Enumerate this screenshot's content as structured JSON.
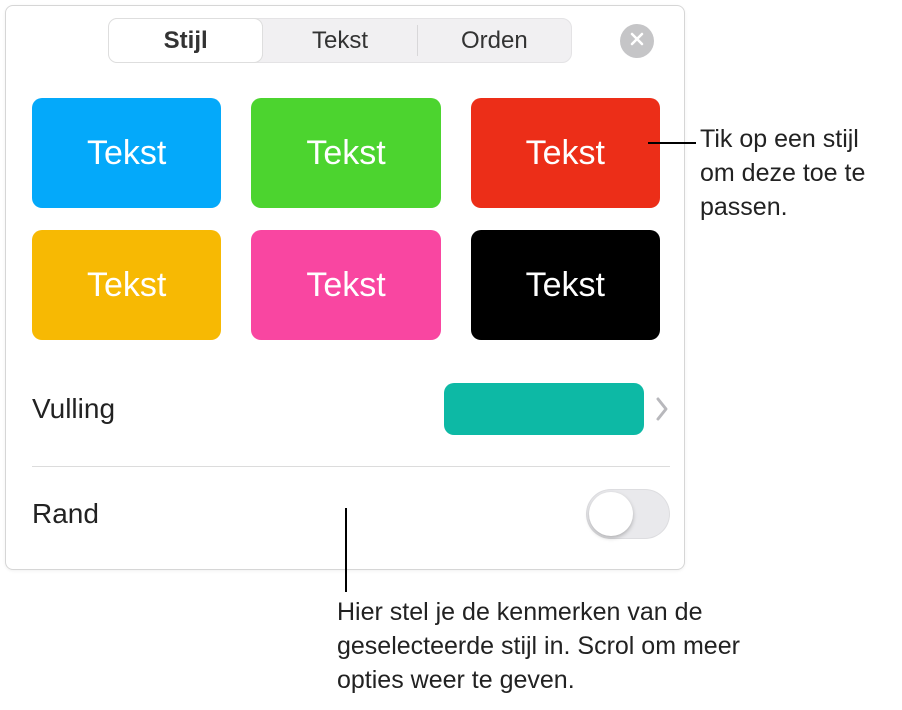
{
  "tabs": {
    "stijl": "Stijl",
    "tekst": "Tekst",
    "orden": "Orden"
  },
  "swatches": [
    {
      "label": "Tekst",
      "color": "#04a9fa"
    },
    {
      "label": "Tekst",
      "color": "#4cd42f"
    },
    {
      "label": "Tekst",
      "color": "#ec2e18"
    },
    {
      "label": "Tekst",
      "color": "#f7b903"
    },
    {
      "label": "Tekst",
      "color": "#f946a1"
    },
    {
      "label": "Tekst",
      "color": "#000000"
    }
  ],
  "rows": {
    "vulling": {
      "label": "Vulling",
      "chip_color": "#0db9a5"
    },
    "rand": {
      "label": "Rand",
      "on": false
    }
  },
  "callouts": {
    "c1": "Tik op een stijl om deze toe te passen.",
    "c2": "Hier stel je de kenmerken van de geselecteerde stijl in. Scrol om meer opties weer te geven."
  }
}
